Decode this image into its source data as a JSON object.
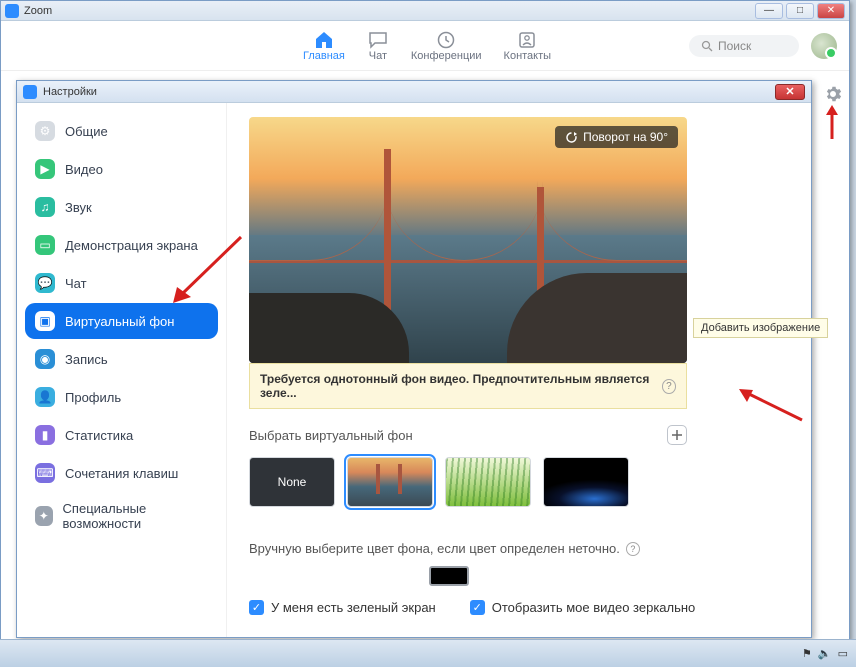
{
  "main_window": {
    "title": "Zoom",
    "nav": [
      {
        "label": "Главная",
        "icon": "home",
        "active": true
      },
      {
        "label": "Чат",
        "icon": "chat"
      },
      {
        "label": "Конференции",
        "icon": "clock"
      },
      {
        "label": "Контакты",
        "icon": "contacts"
      }
    ],
    "search_placeholder": "Поиск"
  },
  "settings_window": {
    "title": "Настройки",
    "sidebar": [
      {
        "label": "Общие",
        "color": "#d6dbe1"
      },
      {
        "label": "Видео",
        "color": "#36c67a"
      },
      {
        "label": "Звук",
        "color": "#2abda0"
      },
      {
        "label": "Демонстрация экрана",
        "color": "#34c67a"
      },
      {
        "label": "Чат",
        "color": "#30b9cf"
      },
      {
        "label": "Виртуальный фон",
        "color": "#ffffff",
        "active": true
      },
      {
        "label": "Запись",
        "color": "#2a8fd6"
      },
      {
        "label": "Профиль",
        "color": "#3aaee0"
      },
      {
        "label": "Статистика",
        "color": "#8a6fe0"
      },
      {
        "label": "Сочетания клавиш",
        "color": "#7a6fe0"
      },
      {
        "label": "Специальные возможности",
        "color": "#9aa3af"
      }
    ]
  },
  "preview": {
    "rotate_label": "Поворот на 90°",
    "warning": "Требуется однотонный фон видео. Предпочтительным является зеле..."
  },
  "choose_label": "Выбрать виртуальный фон",
  "add_tooltip": "Добавить изображение",
  "thumbs": {
    "none": "None"
  },
  "manual_label": "Вручную выберите цвет фона, если цвет определен неточно.",
  "checkbox1": "У меня есть зеленый экран",
  "checkbox2": "Отобразить мое видео зеркально"
}
